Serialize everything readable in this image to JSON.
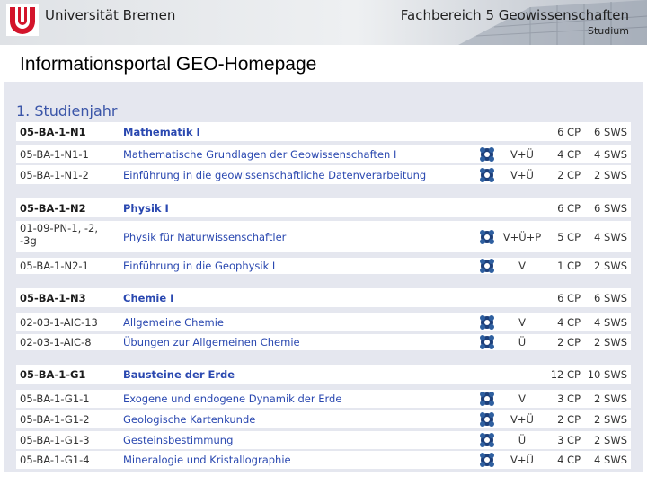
{
  "header": {
    "university": "Universität Bremen",
    "faculty": "Fachbereich 5 Geowissenschaften",
    "section": "Studium",
    "logo": "university-bremen-logo"
  },
  "page_title": "Informationsportal GEO-Homepage",
  "year_heading": "1. Studienjahr",
  "icon_name": "puzzle-icon",
  "colors": {
    "link": "#2a48b0",
    "heading": "#3a55a8",
    "panel": "#e5e7ef"
  },
  "groups": [
    {
      "code": "05-BA-1-N1",
      "title": "Mathematik I",
      "cp": "6 CP",
      "sws": "6 SWS",
      "courses": [
        {
          "code": "05-BA-1-N1-1",
          "title": "Mathematische Grundlagen der Geowissenschaften I",
          "type": "V+Ü",
          "cp": "4 CP",
          "sws": "4 SWS"
        },
        {
          "code": "05-BA-1-N1-2",
          "title": "Einführung in die geowissenschaftliche Datenverarbeitung",
          "type": "V+Ü",
          "cp": "2 CP",
          "sws": "2 SWS"
        }
      ]
    },
    {
      "code": "05-BA-1-N2",
      "title": "Physik I",
      "cp": "6 CP",
      "sws": "6 SWS",
      "courses": [
        {
          "code": "01-09-PN-1, -2,",
          "code2": "-3g",
          "title": "Physik für Naturwissenschaftler",
          "type": "V+Ü+P",
          "cp": "5 CP",
          "sws": "4 SWS"
        },
        {
          "code": "05-BA-1-N2-1",
          "title": "Einführung in die Geophysik I",
          "type": "V",
          "cp": "1 CP",
          "sws": "2 SWS"
        }
      ]
    },
    {
      "code": "05-BA-1-N3",
      "title": "Chemie I",
      "cp": "6 CP",
      "sws": "6 SWS",
      "courses": [
        {
          "code": "02-03-1-AIC-13",
          "title": "Allgemeine Chemie",
          "type": "V",
          "cp": "4 CP",
          "sws": "4 SWS"
        },
        {
          "code": "02-03-1-AIC-8",
          "title": "Übungen zur Allgemeinen Chemie",
          "type": "Ü",
          "cp": "2 CP",
          "sws": "2 SWS"
        }
      ]
    },
    {
      "code": "05-BA-1-G1",
      "title": "Bausteine der Erde",
      "cp": "12 CP",
      "sws": "10 SWS",
      "courses": [
        {
          "code": "05-BA-1-G1-1",
          "title": "Exogene und endogene Dynamik der Erde",
          "type": "V",
          "cp": "3 CP",
          "sws": "2 SWS"
        },
        {
          "code": "05-BA-1-G1-2",
          "title": "Geologische Kartenkunde",
          "type": "V+Ü",
          "cp": "2 CP",
          "sws": "2 SWS"
        },
        {
          "code": "05-BA-1-G1-3",
          "title": "Gesteinsbestimmung",
          "type": "Ü",
          "cp": "3 CP",
          "sws": "2 SWS"
        },
        {
          "code": "05-BA-1-G1-4",
          "title": "Mineralogie und Kristallographie",
          "type": "V+Ü",
          "cp": "4 CP",
          "sws": "4 SWS"
        }
      ]
    }
  ]
}
